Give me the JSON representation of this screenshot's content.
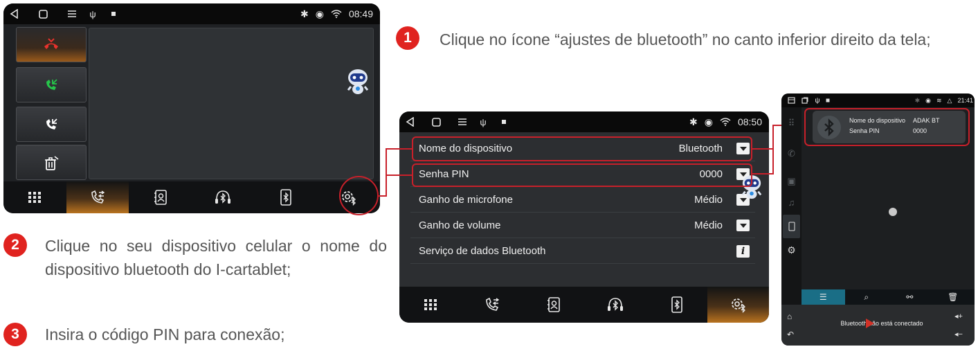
{
  "steps": [
    {
      "number": "1",
      "text": "Clique no ícone “ajustes de bluetooth” no canto inferior direito da tela;"
    },
    {
      "number": "2",
      "text": "Clique no seu dispositivo celular o nome do dispositivo bluetooth do I-cartablet;"
    },
    {
      "number": "3",
      "text": "Insira o código PIN para conexão;"
    }
  ],
  "screen1": {
    "clock": "08:49",
    "call_buttons": [
      "hang-up-icon",
      "answer-call-icon",
      "call-transfer-icon",
      "delete-call-log-icon"
    ],
    "dock": [
      "apps-grid-icon",
      "phone-calls-icon",
      "contacts-icon",
      "bluetooth-music-icon",
      "bluetooth-phone-icon",
      "bluetooth-settings-icon"
    ],
    "active_dock": "phone-calls-icon"
  },
  "screen2": {
    "clock": "08:50",
    "settings": [
      {
        "label": "Nome do dispositivo",
        "value": "Bluetooth",
        "control": "dropdown"
      },
      {
        "label": "Senha PIN",
        "value": "0000",
        "control": "dropdown"
      },
      {
        "label": "Ganho de microfone",
        "value": "Médio",
        "control": "dropdown"
      },
      {
        "label": "Ganho de volume",
        "value": "Médio",
        "control": "dropdown"
      },
      {
        "label": "Serviço de dados Bluetooth",
        "value": "",
        "control": "info"
      }
    ],
    "active_dock": "bluetooth-settings-icon"
  },
  "screen3": {
    "clock": "21:41",
    "device_name_label": "Nome do dispositivo",
    "device_name_value": "ADAK BT",
    "pin_label": "Senha PIN",
    "pin_value": "0000",
    "status": "Bluetooth não está conectado"
  },
  "colors": {
    "accent_red": "#c8202a",
    "step_badge": "#e0231f",
    "active_tab": "#b9731f",
    "portrait_active_tab": "#1a6e86"
  }
}
